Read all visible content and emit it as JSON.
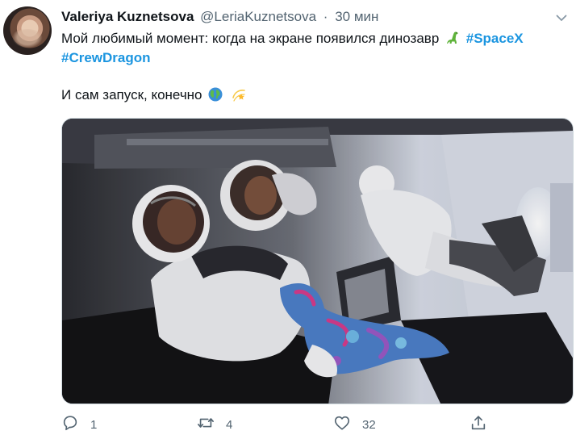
{
  "tweet": {
    "author_name": "Valeriya Kuznetsova",
    "handle": "@LeriaKuznetsova",
    "separator": "·",
    "time": "30 мин",
    "text_part1": "Мой любимый момент: когда на экране появился динозавр",
    "hashtag_spacex": "#SpaceX",
    "hashtag_crewdragon": "#CrewDragon",
    "text_part2": "И сам запуск, конечно",
    "emoji": [
      "dinosaur-emoji",
      "globe-emoji",
      "dizzy-star-emoji"
    ],
    "media": {
      "type": "video-still",
      "subject": "astronauts in spacecraft cabin with plush dinosaur"
    }
  },
  "actions": {
    "reply_count": "1",
    "retweet_count": "4",
    "like_count": "32"
  },
  "colors": {
    "link": "#1b95e0",
    "muted": "#536471",
    "text": "#0f1419",
    "border": "#cfd9de"
  }
}
